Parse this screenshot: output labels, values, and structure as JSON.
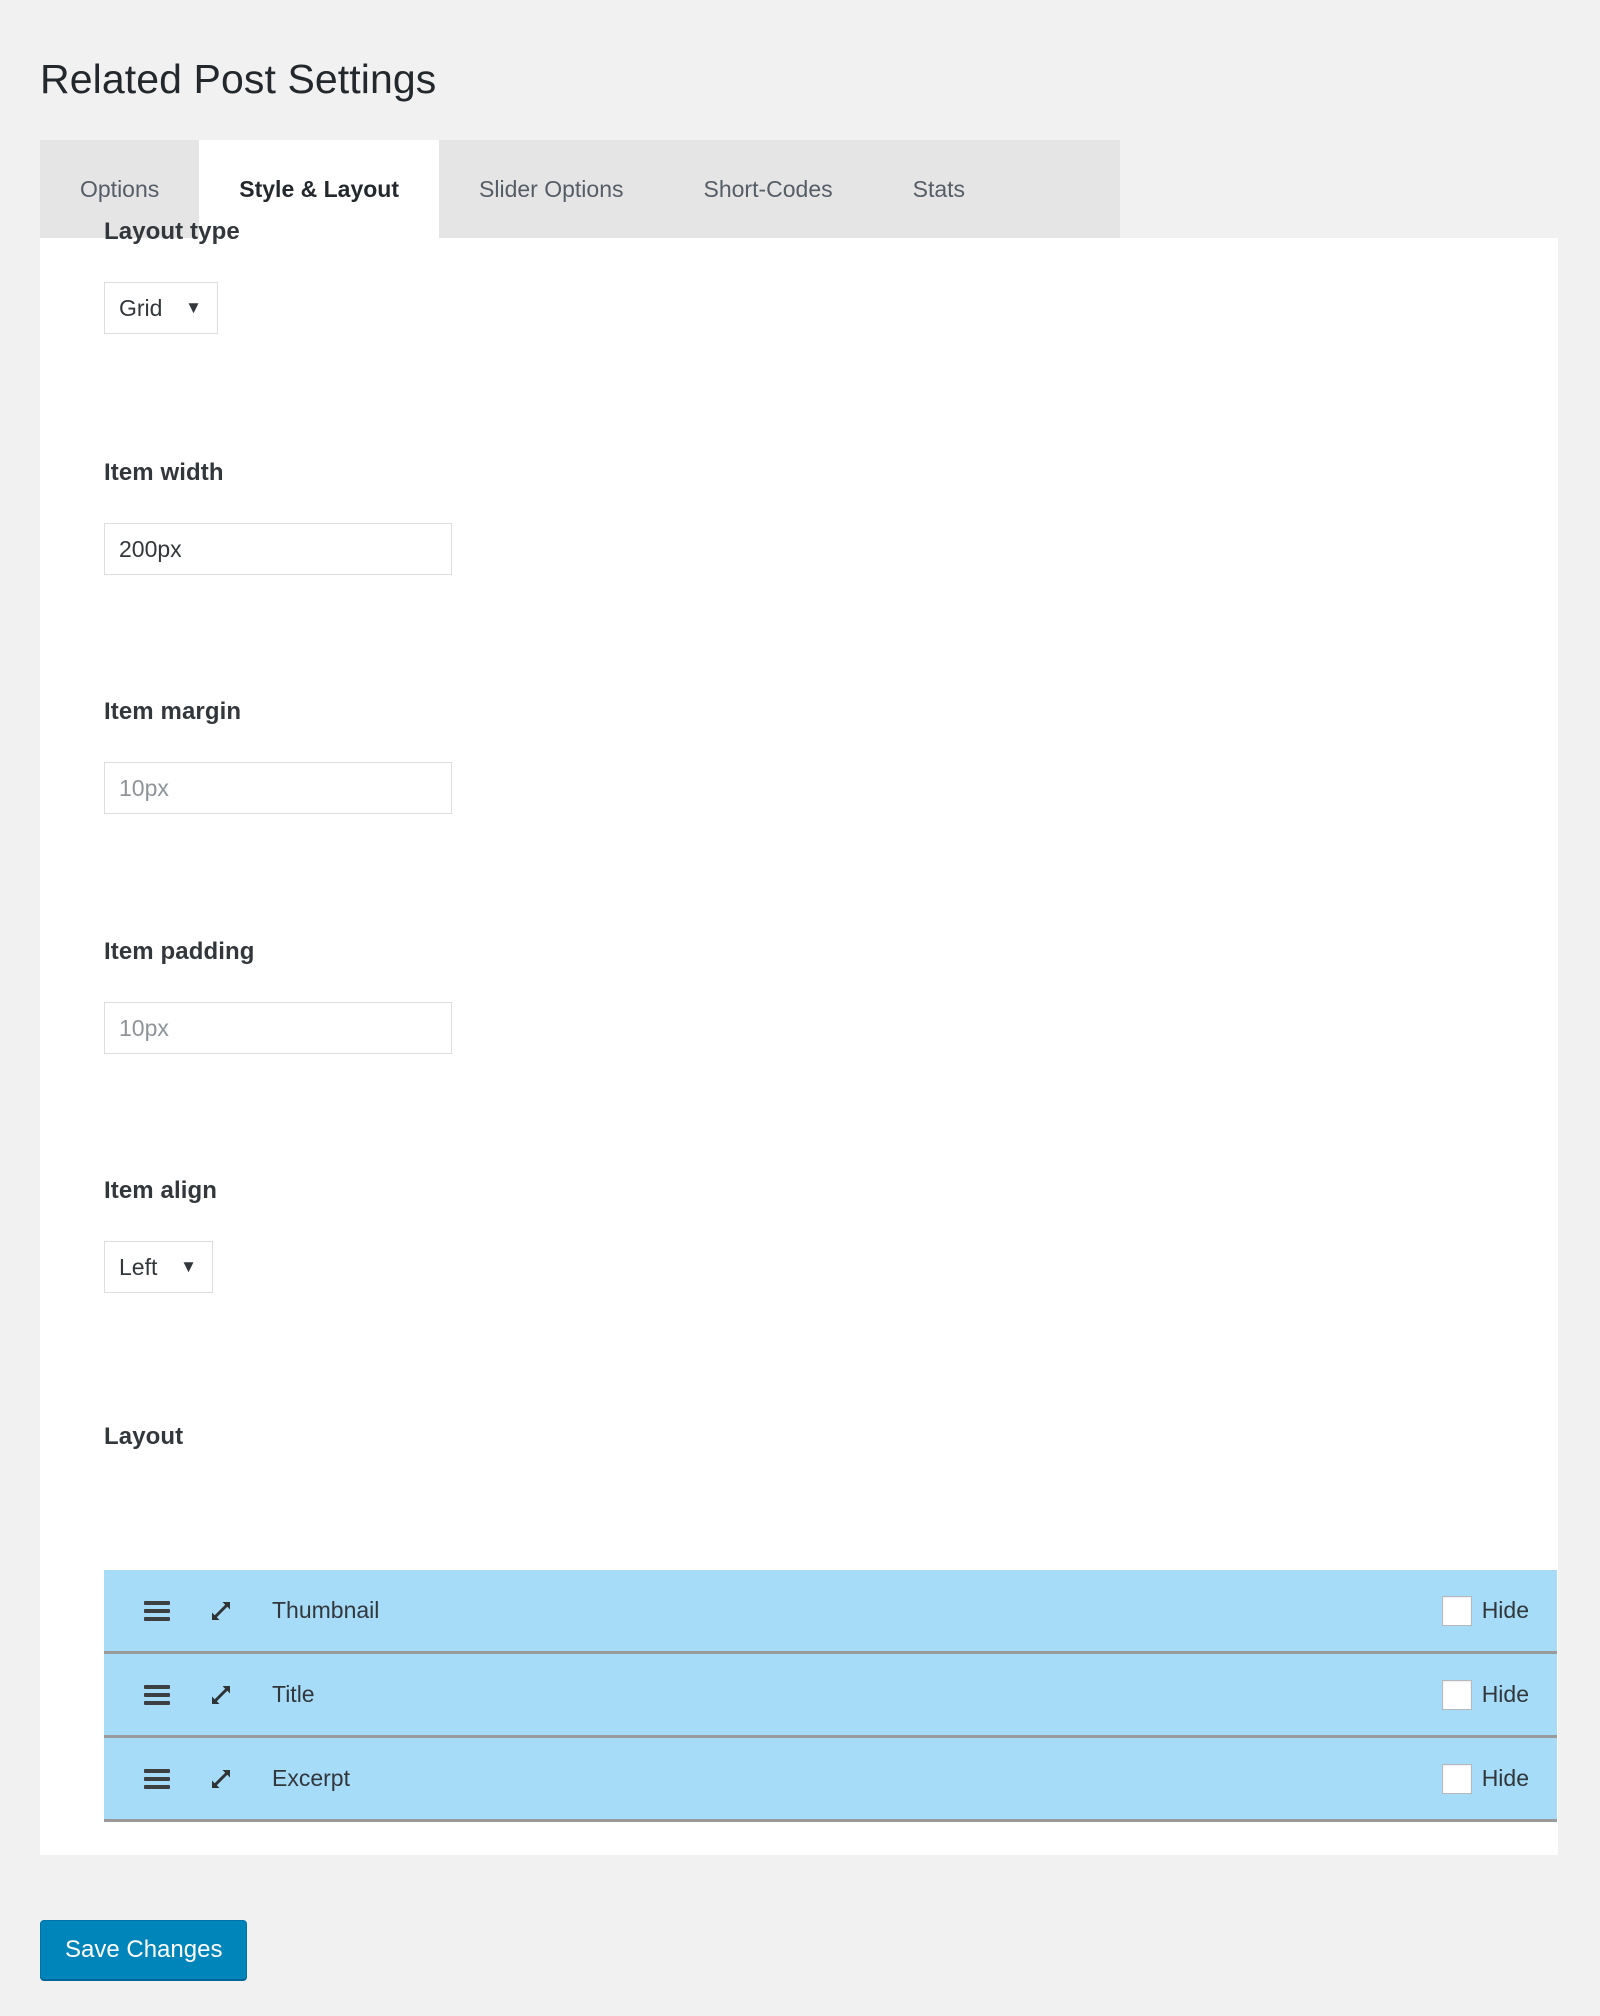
{
  "page": {
    "title": "Related Post Settings",
    "background_color": "#f1f1f1",
    "panel_color": "#ffffff"
  },
  "tabs": [
    {
      "label": "Options",
      "active": false
    },
    {
      "label": "Style & Layout",
      "active": true
    },
    {
      "label": "Slider Options",
      "active": false
    },
    {
      "label": "Short-Codes",
      "active": false
    },
    {
      "label": "Stats",
      "active": false
    }
  ],
  "fields": {
    "layout_type": {
      "label": "Layout type",
      "control": "select",
      "value": "Grid",
      "options": [
        "Grid"
      ],
      "arrow_icon": "▼"
    },
    "item_width": {
      "label": "Item width",
      "control": "text",
      "value": "200px",
      "placeholder": ""
    },
    "item_margin": {
      "label": "Item margin",
      "control": "text",
      "value": "",
      "placeholder": "10px"
    },
    "item_padding": {
      "label": "Item padding",
      "control": "text",
      "value": "",
      "placeholder": "10px"
    },
    "item_align": {
      "label": "Item align",
      "control": "select",
      "value": "Left",
      "options": [
        "Left"
      ],
      "arrow_icon": "▼"
    }
  },
  "layout_section": {
    "label": "Layout",
    "row_color": "#a6dcf8",
    "hide_label": "Hide",
    "drag_icon": "hamburger-icon",
    "resize_icon": "↗",
    "rows": [
      {
        "label": "Thumbnail",
        "hidden": false
      },
      {
        "label": "Title",
        "hidden": false
      },
      {
        "label": "Excerpt",
        "hidden": false
      }
    ]
  },
  "footer": {
    "save_label": "Save Changes",
    "save_color": "#0085ba"
  }
}
